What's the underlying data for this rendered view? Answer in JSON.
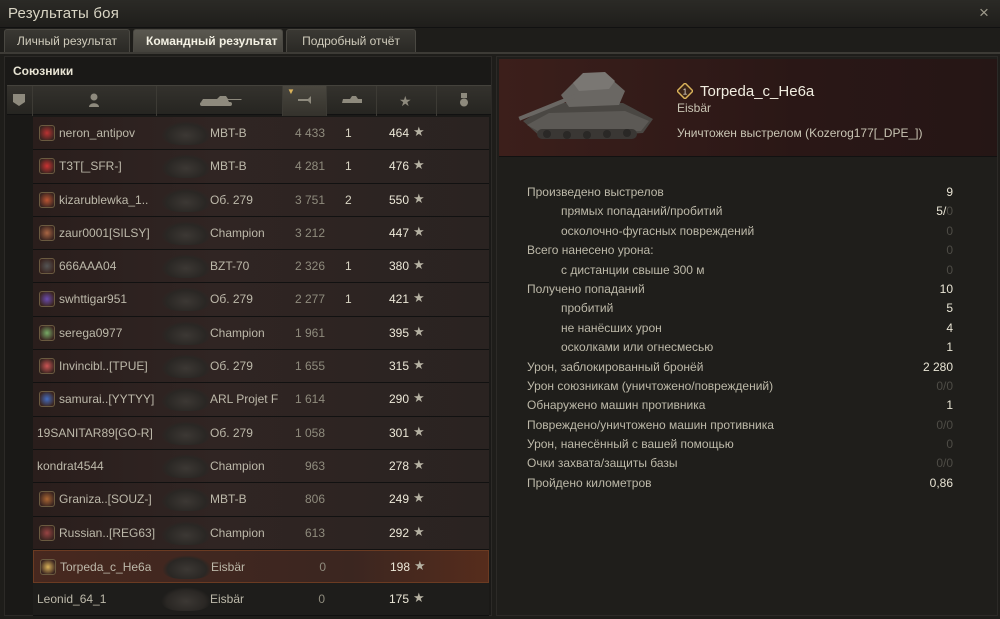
{
  "window": {
    "title": "Результаты боя",
    "close_icon": "×"
  },
  "tabs": [
    "Личный результат",
    "Командный результат",
    "Подробный отчёт"
  ],
  "left": {
    "section_label": "Союзники",
    "star_glyph": "★",
    "rows": [
      {
        "player": "neron_antipov",
        "tank": "MBT-B",
        "damage": "4 433",
        "kills": "1",
        "xp": "464"
      },
      {
        "player": "T3T[_SFR-]",
        "tank": "MBT-B",
        "damage": "4 281",
        "kills": "1",
        "xp": "476"
      },
      {
        "player": "kizarublewka_1..",
        "tank": "Об. 279",
        "damage": "3 751",
        "kills": "2",
        "xp": "550"
      },
      {
        "player": "zaur0001[SILSY]",
        "tank": "Champion",
        "damage": "3 212",
        "kills": "",
        "xp": "447"
      },
      {
        "player": "666AAA04",
        "tank": "BZT-70",
        "damage": "2 326",
        "kills": "1",
        "xp": "380"
      },
      {
        "player": "swhttigar951",
        "tank": "Об. 279",
        "damage": "2 277",
        "kills": "1",
        "xp": "421"
      },
      {
        "player": "serega0977",
        "tank": "Champion",
        "damage": "1 961",
        "kills": "",
        "xp": "395"
      },
      {
        "player": "Invincibl..[TPUE]",
        "tank": "Об. 279",
        "damage": "1 655",
        "kills": "",
        "xp": "315"
      },
      {
        "player": "samurai..[YYTYY]",
        "tank": "ARL Projet F",
        "damage": "1 614",
        "kills": "",
        "xp": "290"
      },
      {
        "player": "19SANITAR89[GO-R]",
        "tank": "Об. 279",
        "damage": "1 058",
        "kills": "",
        "xp": "301"
      },
      {
        "player": "kondrat4544",
        "tank": "Champion",
        "damage": "963",
        "kills": "",
        "xp": "278"
      },
      {
        "player": "Graniza..[SOUZ-]",
        "tank": "MBT-B",
        "damage": "806",
        "kills": "",
        "xp": "249"
      },
      {
        "player": "Russian..[REG63]",
        "tank": "Champion",
        "damage": "613",
        "kills": "",
        "xp": "292"
      },
      {
        "player": "Torpeda_c_He6a",
        "tank": "Eisbär",
        "damage": "0",
        "kills": "",
        "xp": "198"
      },
      {
        "player": "Leonid_64_1",
        "tank": "Eisbär",
        "damage": "0",
        "kills": "",
        "xp": "175"
      }
    ]
  },
  "right": {
    "player": "Torpeda_c_He6a",
    "tank": "Eisbär",
    "status": "Уничтожен выстрелом (Kozerog177[_DPE_])",
    "stats": [
      {
        "label": "Произведено выстрелов",
        "value": "9",
        "sub": false,
        "dim": false
      },
      {
        "label": "прямых попаданий/пробитий",
        "value": "5/",
        "value_dim": "0",
        "sub": true,
        "dim": false
      },
      {
        "label": "осколочно-фугасных повреждений",
        "value": "0",
        "sub": true,
        "dim": true
      },
      {
        "label": "Всего нанесено урона:",
        "value": "0",
        "sub": false,
        "dim": true
      },
      {
        "label": "с дистанции свыше 300 м",
        "value": "0",
        "sub": true,
        "dim": true
      },
      {
        "label": "Получено попаданий",
        "value": "10",
        "sub": false,
        "dim": false
      },
      {
        "label": "пробитий",
        "value": "5",
        "sub": true,
        "dim": false
      },
      {
        "label": "не нанёсших урон",
        "value": "4",
        "sub": true,
        "dim": false
      },
      {
        "label": "осколками или огнесмесью",
        "value": "1",
        "sub": true,
        "dim": false
      },
      {
        "label": "Урон, заблокированный бронёй",
        "value": "2 280",
        "sub": false,
        "dim": false
      },
      {
        "label": "Урон союзникам (уничтожено/повреждений)",
        "value": "0/0",
        "sub": false,
        "dim": true
      },
      {
        "label": "Обнаружено машин противника",
        "value": "1",
        "sub": false,
        "dim": false
      },
      {
        "label": "Повреждено/уничтожено машин противника",
        "value": "0/0",
        "sub": false,
        "dim": true
      },
      {
        "label": "Урон, нанесённый с вашей помощью",
        "value": "0",
        "sub": false,
        "dim": true
      },
      {
        "label": "Очки захвата/защиты базы",
        "value": "0/0",
        "sub": false,
        "dim": true
      },
      {
        "label": "Пройдено километров",
        "value": "0,86",
        "sub": false,
        "dim": false
      }
    ]
  },
  "icons": {
    "close": "close-icon",
    "header_columns": [
      "squad-icon",
      "player-icon",
      "tank-icon",
      "damage-icon",
      "kills-icon",
      "xp-star-icon",
      "medal-icon"
    ]
  },
  "colors": {
    "accent_gold": "#d9b25a",
    "enemy_row": "#302523",
    "self_row": "#47281f"
  }
}
